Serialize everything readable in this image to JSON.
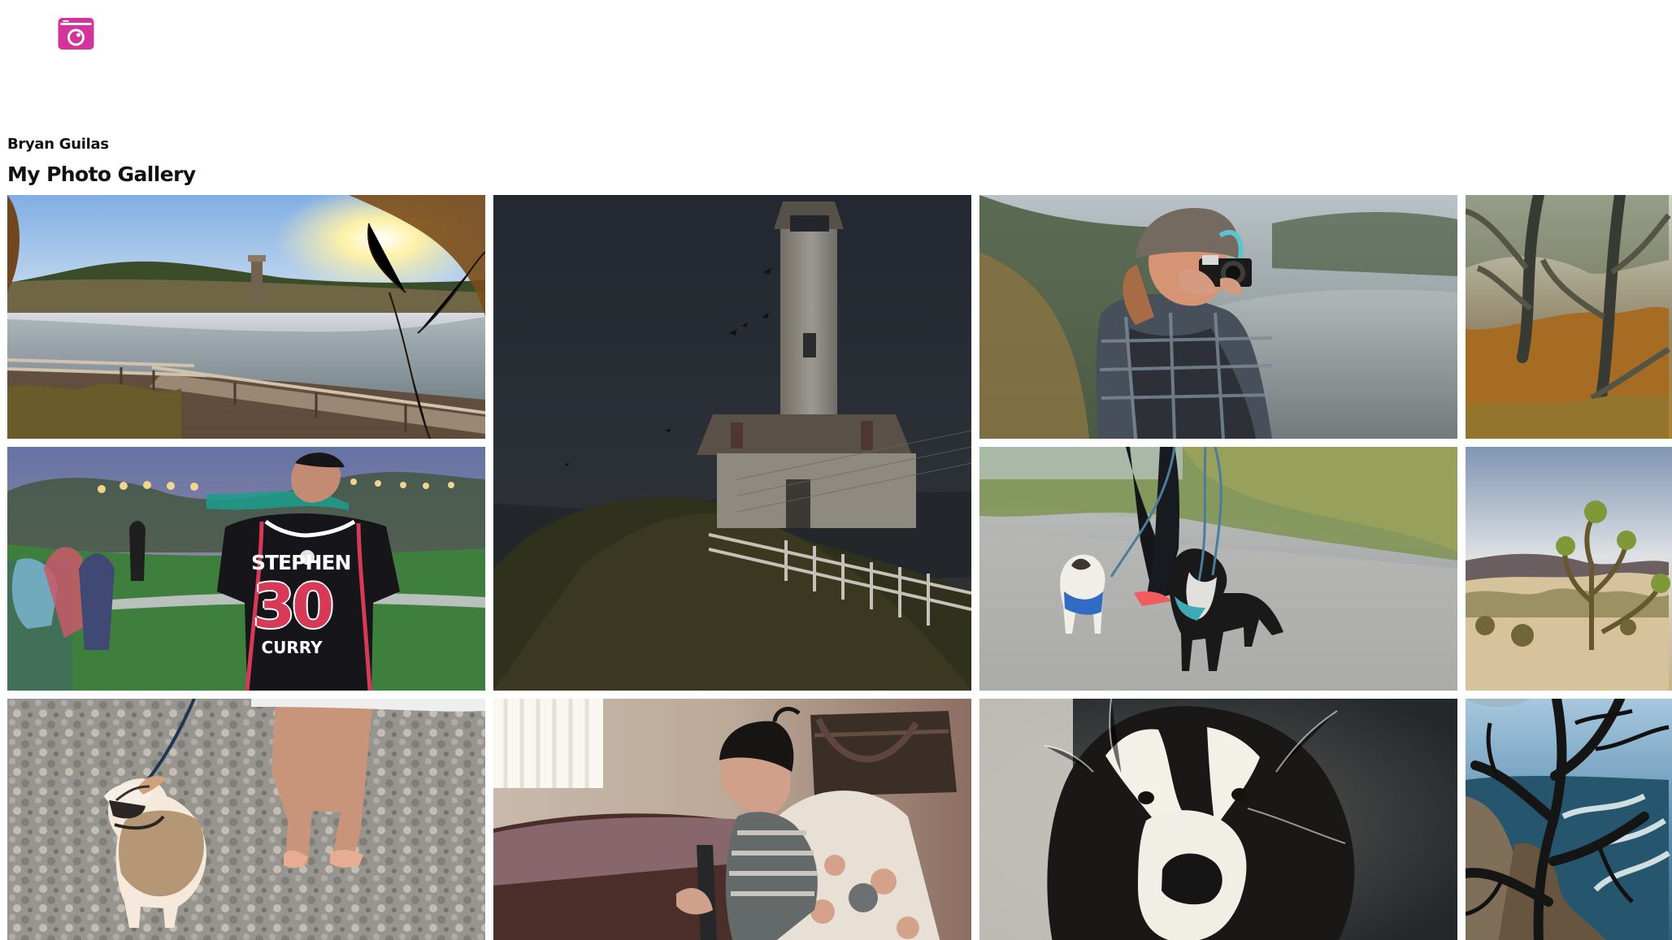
{
  "header": {
    "logo_icon": "camera-icon",
    "brand_color": "#d4339b",
    "author": "Bryan Guilas",
    "title": "My Photo Gallery"
  },
  "gallery": {
    "photos": [
      {
        "subject": "lake-pier-sunrise"
      },
      {
        "subject": "lighthouse-on-cliff"
      },
      {
        "subject": "photographer-with-camera"
      },
      {
        "subject": "cypress-trees"
      },
      {
        "subject": "jersey-in-park",
        "jersey_name": "STEPHEN",
        "jersey_number": "30",
        "jersey_bottom": "CURRY"
      },
      {
        "subject": "two-dogs-on-leash"
      },
      {
        "subject": "joshua-tree"
      },
      {
        "subject": "chihuahua-sweater"
      },
      {
        "subject": "toddler-in-bedroom"
      },
      {
        "subject": "black-white-dog-closeup"
      },
      {
        "subject": "cliff-tree-coast"
      }
    ]
  }
}
